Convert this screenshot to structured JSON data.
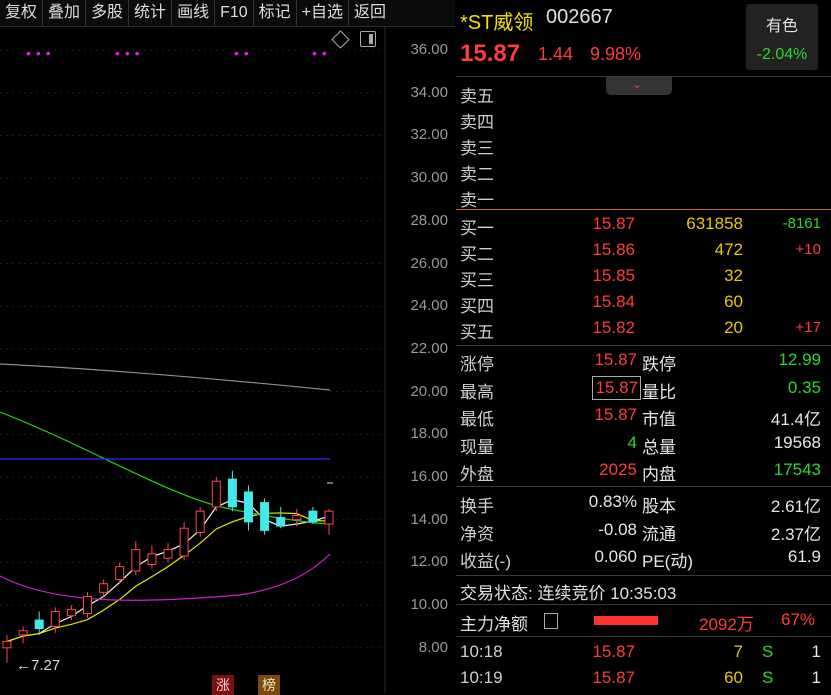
{
  "toolbar": {
    "items": [
      "复权",
      "叠加",
      "多股",
      "统计",
      "画线",
      "F10",
      "标记",
      "+自选",
      "返回"
    ]
  },
  "chart": {
    "y_ticks": [
      "36.00",
      "34.00",
      "32.00",
      "30.00",
      "28.00",
      "26.00",
      "24.00",
      "22.00",
      "20.00",
      "18.00",
      "16.00",
      "14.00",
      "12.00",
      "10.00",
      "8.00"
    ],
    "low_label": "←7.27",
    "bottom_tags": [
      "涨",
      "榜"
    ],
    "dots": "•••"
  },
  "chart_data": {
    "type": "candlestick",
    "ylim": [
      8,
      36
    ],
    "candles": [
      {
        "o": 8.0,
        "h": 8.6,
        "l": 7.3,
        "c": 8.3
      },
      {
        "o": 8.6,
        "h": 9.0,
        "l": 8.2,
        "c": 8.8
      },
      {
        "o": 9.3,
        "h": 9.7,
        "l": 8.6,
        "c": 8.9
      },
      {
        "o": 9.0,
        "h": 9.9,
        "l": 8.7,
        "c": 9.7
      },
      {
        "o": 9.5,
        "h": 10.0,
        "l": 9.3,
        "c": 9.8
      },
      {
        "o": 9.6,
        "h": 10.6,
        "l": 9.4,
        "c": 10.4
      },
      {
        "o": 10.6,
        "h": 11.2,
        "l": 10.4,
        "c": 11.0
      },
      {
        "o": 11.2,
        "h": 12.0,
        "l": 11.0,
        "c": 11.8
      },
      {
        "o": 11.6,
        "h": 13.0,
        "l": 11.4,
        "c": 12.6
      },
      {
        "o": 11.9,
        "h": 12.8,
        "l": 11.7,
        "c": 12.4
      },
      {
        "o": 12.2,
        "h": 12.9,
        "l": 12.0,
        "c": 12.6
      },
      {
        "o": 12.3,
        "h": 13.9,
        "l": 12.1,
        "c": 13.6
      },
      {
        "o": 13.4,
        "h": 14.6,
        "l": 13.2,
        "c": 14.4
      },
      {
        "o": 14.6,
        "h": 16.0,
        "l": 14.4,
        "c": 15.8
      },
      {
        "o": 15.9,
        "h": 16.3,
        "l": 14.4,
        "c": 14.6
      },
      {
        "o": 15.3,
        "h": 15.6,
        "l": 13.5,
        "c": 13.9
      },
      {
        "o": 14.8,
        "h": 15.0,
        "l": 13.3,
        "c": 13.5
      },
      {
        "o": 14.1,
        "h": 14.6,
        "l": 13.6,
        "c": 13.7
      },
      {
        "o": 14.0,
        "h": 14.5,
        "l": 13.7,
        "c": 14.2
      },
      {
        "o": 14.4,
        "h": 14.6,
        "l": 13.8,
        "c": 13.9
      },
      {
        "o": 13.8,
        "h": 14.5,
        "l": 13.3,
        "c": 14.4
      }
    ]
  },
  "quote": {
    "name": "*ST威领",
    "code": "002667",
    "price": "15.87",
    "change": "1.44",
    "pct": "9.98%",
    "color_btn": "有色",
    "color_pct": "-2.04%",
    "expand_icon": "chevron-down-icon"
  },
  "ask": [
    {
      "label": "卖五"
    },
    {
      "label": "卖四"
    },
    {
      "label": "卖三"
    },
    {
      "label": "卖二"
    },
    {
      "label": "卖一"
    }
  ],
  "bid": [
    {
      "label": "买一",
      "price": "15.87",
      "vol": "631858",
      "chg": "-8161"
    },
    {
      "label": "买二",
      "price": "15.86",
      "vol": "472",
      "chg": "+10"
    },
    {
      "label": "买三",
      "price": "15.85",
      "vol": "32",
      "chg": ""
    },
    {
      "label": "买四",
      "price": "15.84",
      "vol": "60",
      "chg": ""
    },
    {
      "label": "买五",
      "price": "15.82",
      "vol": "20",
      "chg": "+17"
    }
  ],
  "stats1": [
    {
      "l1": "涨停",
      "v1": "15.87",
      "l2": "跌停",
      "v2": "12.99"
    },
    {
      "l1": "最高",
      "v1": "15.87",
      "l2": "量比",
      "v2": "0.35"
    },
    {
      "l1": "最低",
      "v1": "15.87",
      "l2": "市值",
      "v2": "41.4亿"
    },
    {
      "l1": "现量",
      "v1": "4",
      "l2": "总量",
      "v2": "19568"
    },
    {
      "l1": "外盘",
      "v1": "2025",
      "l2": "内盘",
      "v2": "17543"
    }
  ],
  "stats2": [
    {
      "l1": "换手",
      "v1": "0.83%",
      "l2": "股本",
      "v2": "2.61亿"
    },
    {
      "l1": "净资",
      "v1": "-0.08",
      "l2": "流通",
      "v2": "2.37亿"
    },
    {
      "l1": "收益(-)",
      "v1": "0.060",
      "l2": "PE(动)",
      "v2": "61.9"
    }
  ],
  "status": {
    "text": "交易状态: 连续竞价 10:35:03"
  },
  "flow": {
    "label": "主力净额",
    "value": "2092万",
    "pct": "67%",
    "bar_fraction": 0.67
  },
  "ticks": [
    {
      "time": "10:18",
      "price": "15.87",
      "vol": "7",
      "side": "S",
      "n": "1"
    },
    {
      "time": "10:19",
      "price": "15.87",
      "vol": "60",
      "side": "S",
      "n": "1"
    }
  ]
}
